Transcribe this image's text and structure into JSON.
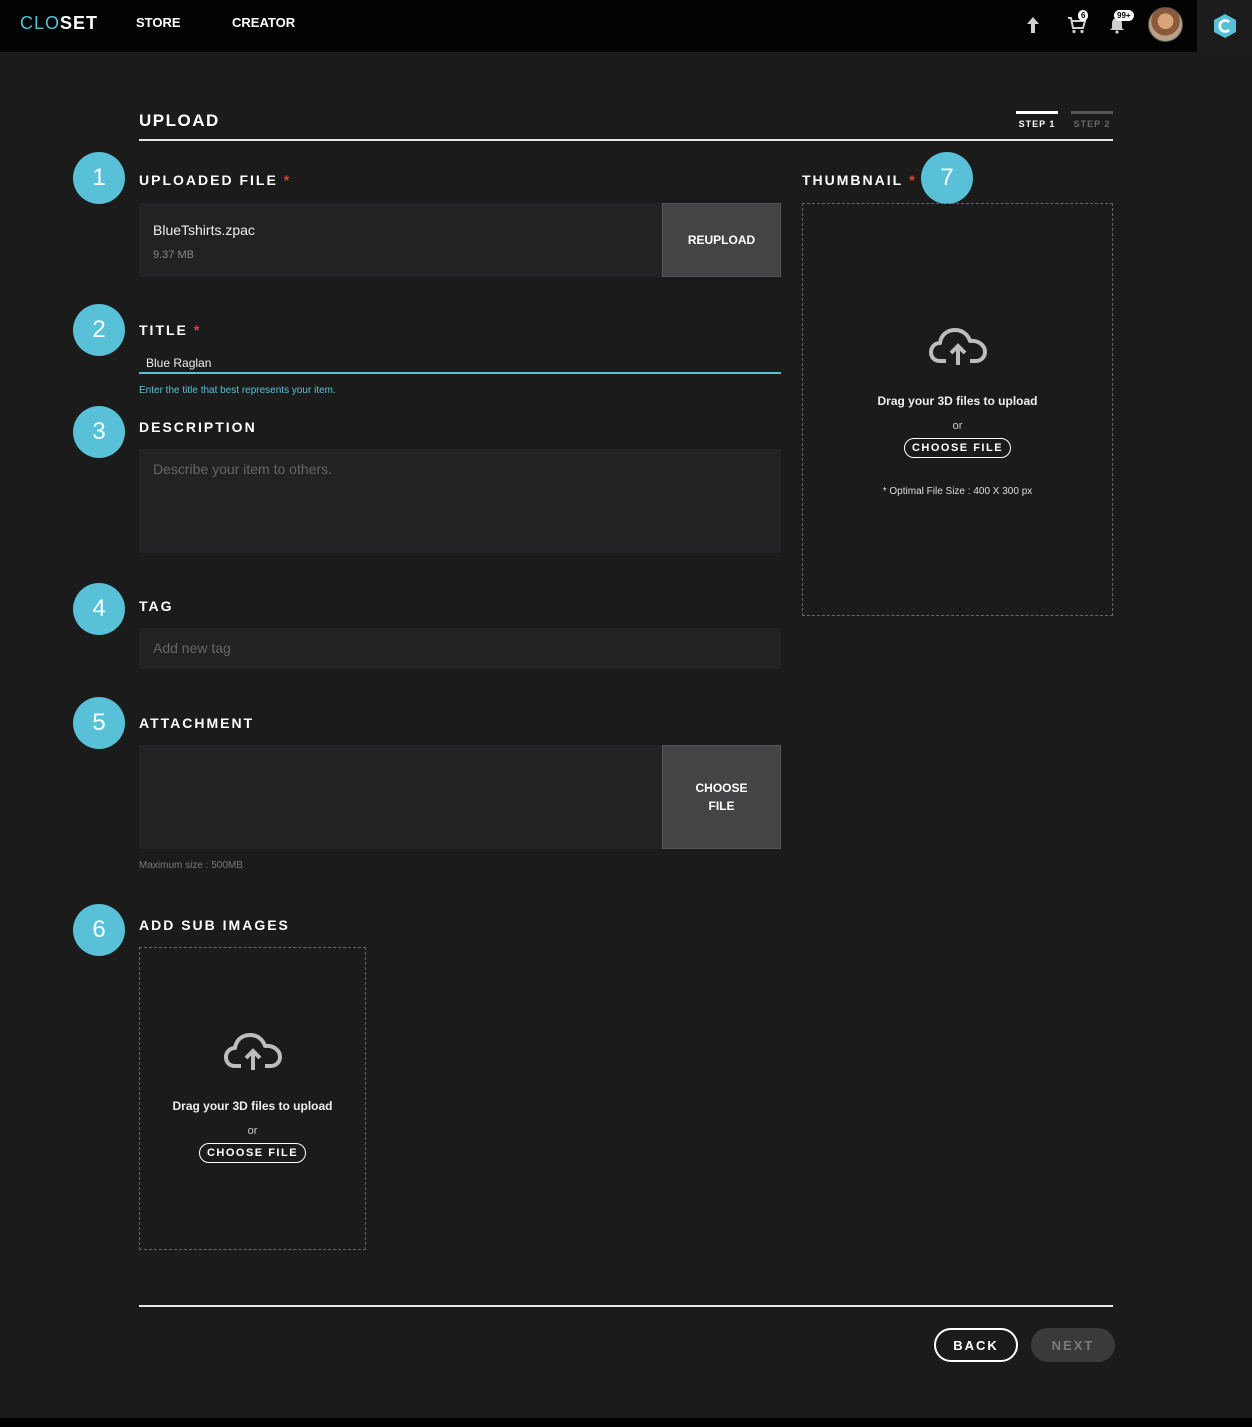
{
  "header": {
    "logo_left": "CLO",
    "logo_right": "SET",
    "nav": [
      {
        "label": "STORE"
      },
      {
        "label": "CREATOR"
      }
    ],
    "cart_count": "6",
    "notification_count": "99+",
    "icons": [
      "upload-arrow-icon",
      "cart-icon",
      "bell-icon",
      "avatar",
      "app-logo-icon"
    ]
  },
  "page": {
    "title": "UPLOAD",
    "steps": [
      {
        "label": "STEP 1",
        "active": true
      },
      {
        "label": "STEP 2",
        "active": false
      }
    ]
  },
  "markers": [
    "1",
    "2",
    "3",
    "4",
    "5",
    "6",
    "7"
  ],
  "uploaded_file": {
    "label": "UPLOADED FILE",
    "required": "*",
    "file_name": "BlueTshirts.zpac",
    "file_size": "9.37 MB",
    "reupload_label": "REUPLOAD"
  },
  "title_field": {
    "label": "TITLE",
    "required": "*",
    "value": "Blue Raglan",
    "helper": "Enter the title that best represents your item."
  },
  "description": {
    "label": "DESCRIPTION",
    "placeholder": "Describe your item to others."
  },
  "tag": {
    "label": "TAG",
    "placeholder": "Add new tag"
  },
  "attachment": {
    "label": "ATTACHMENT",
    "button_line1": "CHOOSE",
    "button_line2": "FILE",
    "helper": "Maximum size : 500MB"
  },
  "sub_images": {
    "label": "ADD SUB IMAGES",
    "drop_text": "Drag your 3D files to upload",
    "or_text": "or",
    "choose_label": "CHOOSE FILE"
  },
  "thumbnail": {
    "label": "THUMBNAIL",
    "required": "*",
    "drop_text": "Drag your 3D files to upload",
    "or_text": "or",
    "choose_label": "CHOOSE FILE",
    "note": "* Optimal File Size : 400 X 300 px"
  },
  "footer": {
    "back_label": "BACK",
    "next_label": "NEXT"
  },
  "colors": {
    "accent": "#58c1d8",
    "required": "#e0413b",
    "background": "#1b1b1c",
    "field": "#222224"
  }
}
